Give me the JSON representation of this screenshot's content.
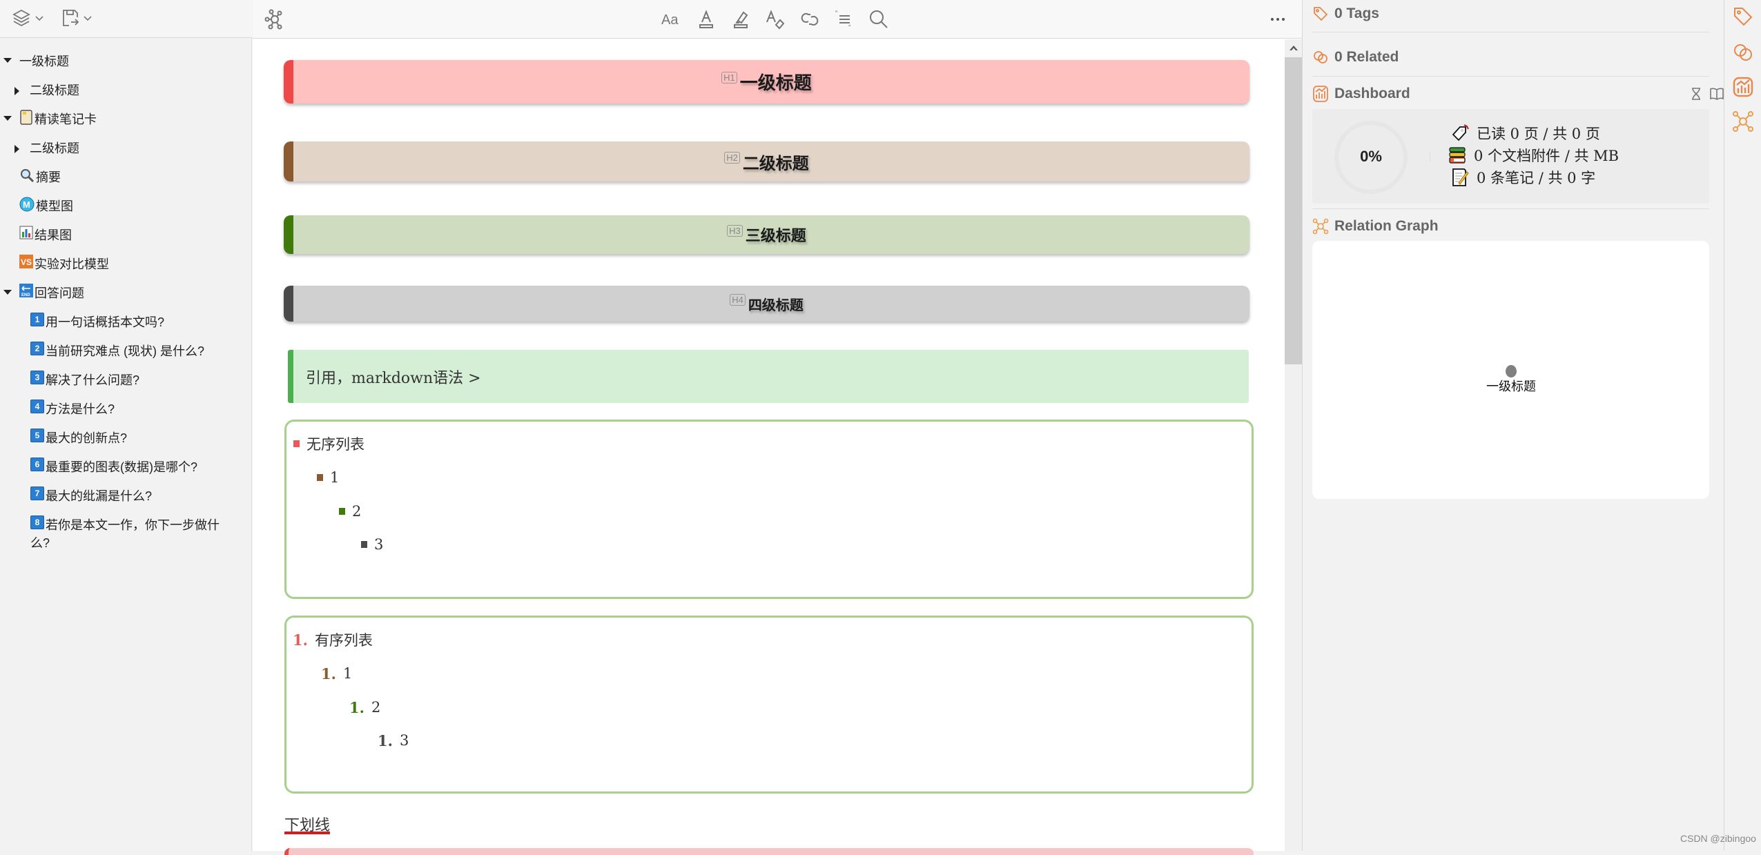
{
  "sidebar": {
    "toolbar": {
      "layers_icon": "layers-icon",
      "export_icon": "export-icon"
    },
    "outline": [
      {
        "label": "一级标题",
        "level": 0,
        "expanded": true,
        "icon": null
      },
      {
        "label": "二级标题",
        "level": 1,
        "expanded": false,
        "icon": null
      },
      {
        "label": "精读笔记卡",
        "level": 0,
        "expanded": true,
        "icon": "notebook-icon"
      },
      {
        "label": "二级标题",
        "level": 1,
        "expanded": false,
        "icon": null
      },
      {
        "label": "摘要",
        "level": 1,
        "icon": "magnifier-icon"
      },
      {
        "label": "模型图",
        "level": 1,
        "icon": "m-circle-icon"
      },
      {
        "label": "结果图",
        "level": 1,
        "icon": "bar-chart-icon"
      },
      {
        "label": "实验对比模型",
        "level": 1,
        "icon": "vs-icon"
      },
      {
        "label": "回答问题",
        "level": 0,
        "expanded": true,
        "icon": "end-icon"
      },
      {
        "label": "用一句话概括本文吗?",
        "level": 2,
        "num": "1"
      },
      {
        "label": "当前研究难点 (现状) 是什么?",
        "level": 2,
        "num": "2"
      },
      {
        "label": "解决了什么问题?",
        "level": 2,
        "num": "3"
      },
      {
        "label": "方法是什么?",
        "level": 2,
        "num": "4"
      },
      {
        "label": "最大的创新点?",
        "level": 2,
        "num": "5"
      },
      {
        "label": "最重要的图表(数据)是哪个?",
        "level": 2,
        "num": "6"
      },
      {
        "label": "最大的纰漏是什么?",
        "level": 2,
        "num": "7"
      },
      {
        "label": "若你是本文一作，你下一步做什",
        "label_cont": "么?",
        "level": 2,
        "num": "8"
      }
    ]
  },
  "editor": {
    "toolbar": {
      "graph_icon": "graph-icon",
      "tools": [
        "font-icon",
        "text-color-icon",
        "highlight-icon",
        "clear-format-icon",
        "link-icon",
        "quote-icon",
        "search-icon"
      ],
      "more_icon": "more-icon"
    },
    "headings": [
      {
        "badge": "H1",
        "text": "一级标题",
        "bg": "#ffc0c0",
        "bar": "#f04848"
      },
      {
        "badge": "H2",
        "text": "二级标题",
        "bg": "#e2d5c8",
        "bar": "#8c5a30"
      },
      {
        "badge": "H3",
        "text": "三级标题",
        "bg": "#cfdcbf",
        "bar": "#3f7a0a"
      },
      {
        "badge": "H4",
        "text": "四级标题",
        "bg": "#d0d0d0",
        "bar": "#4a4a4a"
      }
    ],
    "quote": "引用，markdown语法 >",
    "unordered_list": [
      {
        "text": "无序列表",
        "color": "#e85a5a"
      },
      {
        "text": "1",
        "color": "#8c5a30"
      },
      {
        "text": "2",
        "color": "#3f7a0a"
      },
      {
        "text": "3",
        "color": "#4a4a4a"
      }
    ],
    "ordered_list": [
      {
        "marker": "1.",
        "text": "有序列表",
        "color": "#e85a5a"
      },
      {
        "marker": "1.",
        "text": "1",
        "color": "#8c5a30"
      },
      {
        "marker": "1.",
        "text": "2",
        "color": "#3f7a0a"
      },
      {
        "marker": "1.",
        "text": "3",
        "color": "#4a4a4a"
      }
    ],
    "underline_text": "下划线"
  },
  "right_panel": {
    "tags": {
      "title": "0 Tags"
    },
    "related": {
      "title": "0 Related"
    },
    "dashboard": {
      "title": "Dashboard",
      "progress": "0%",
      "progress_value": 0,
      "stats": [
        "已读 0 页 / 共 0 页",
        "0 个文档附件 / 共 MB",
        "0 条笔记 / 共 0 字"
      ]
    },
    "relation_graph": {
      "title": "Relation Graph",
      "node_label": "一级标题"
    }
  },
  "icon_rail": [
    "tag-icon",
    "link-icon",
    "dashboard-icon",
    "graph-icon"
  ],
  "watermark": "CSDN @zibingoo",
  "colors": {
    "accent_orange": "#e8874a",
    "list_border": "#a8d08d",
    "quote_bar": "#4caf50"
  }
}
